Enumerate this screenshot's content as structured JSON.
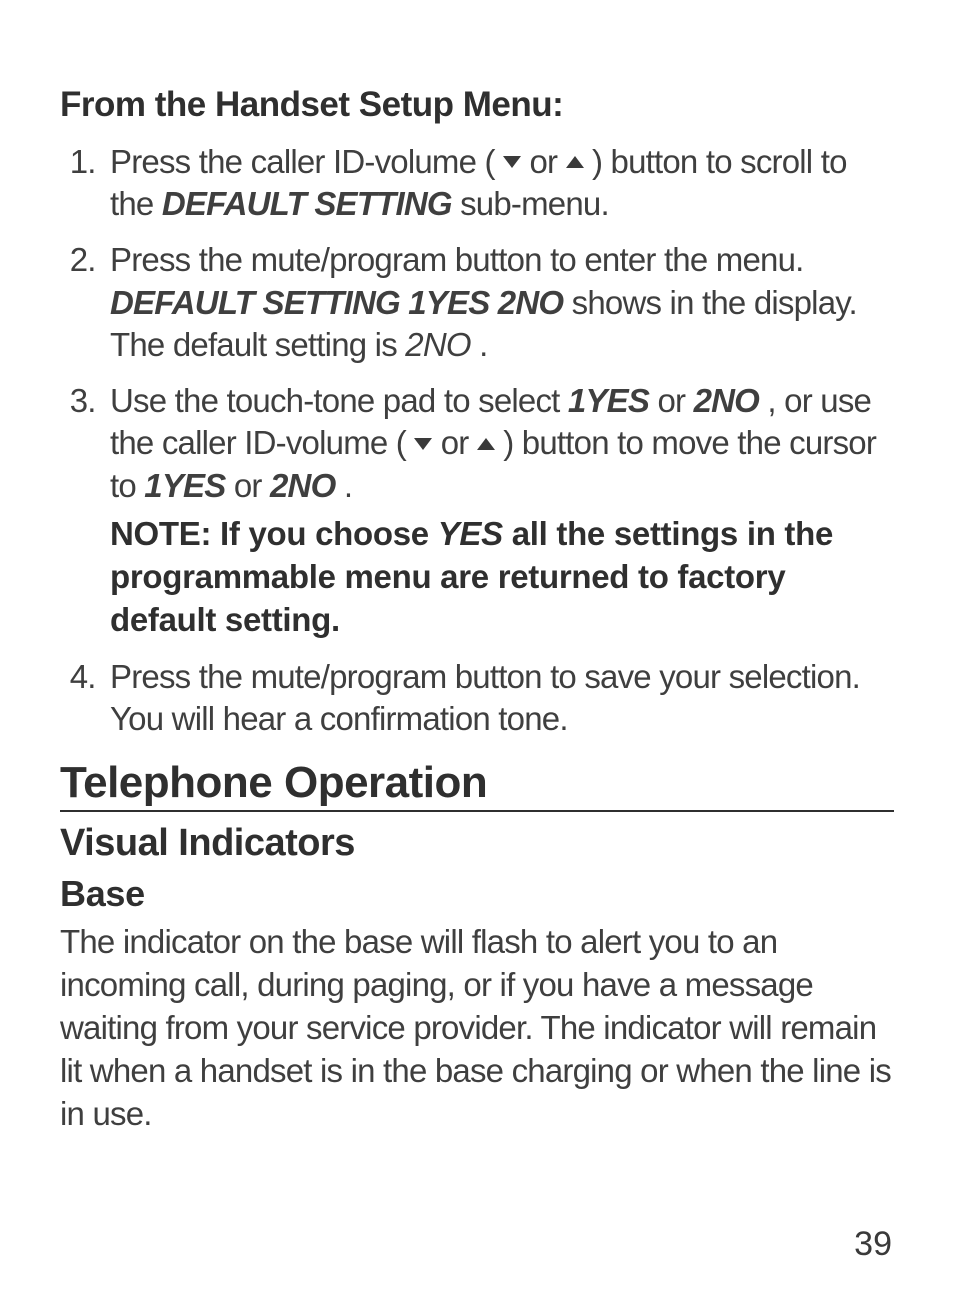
{
  "menuHeading": "From the Handset Setup Menu:",
  "steps": {
    "s1": {
      "t1": "Press the caller ID-volume ( ",
      "t2": " or ",
      "t3": " ) button to scroll to the ",
      "default_setting": "DEFAULT SETTING",
      "t4": " sub-menu."
    },
    "s2": {
      "t1": "Press the mute/program button to enter the menu. ",
      "dsyn": "DEFAULT SETTING 1YES 2NO",
      "t2": " shows in the display. The default setting is ",
      "two_no": "2NO",
      "t3": "."
    },
    "s3": {
      "t1": "Use the touch-tone pad to select ",
      "yes": "1YES",
      "or1": " or ",
      "no": "2NO",
      "t2": ", or use the caller ID-volume ( ",
      "or2": " or ",
      "t3": " ) button to move the cursor to ",
      "yes2": "1YES",
      "or3": " or ",
      "no2": "2NO",
      "t4": "."
    },
    "note": {
      "t1": "NOTE: If you choose ",
      "yes": "YES",
      "t2": " all the settings in the programmable menu are returned to factory default setting."
    },
    "s4": "Press the mute/program button to save your selection. You will hear a confirmation tone."
  },
  "sectionHeading": "Telephone Operation",
  "subHeading": "Visual Indicators",
  "subHeading2": "Base",
  "basePara": "The indicator on the base will flash to alert you to an incoming call, during paging, or if you have a message waiting from your service provider. The indicator will remain lit when a handset is in the base charging or when the line is in use.",
  "pageNumber": "39",
  "icons": {
    "down": "down-triangle",
    "up": "up-triangle"
  }
}
